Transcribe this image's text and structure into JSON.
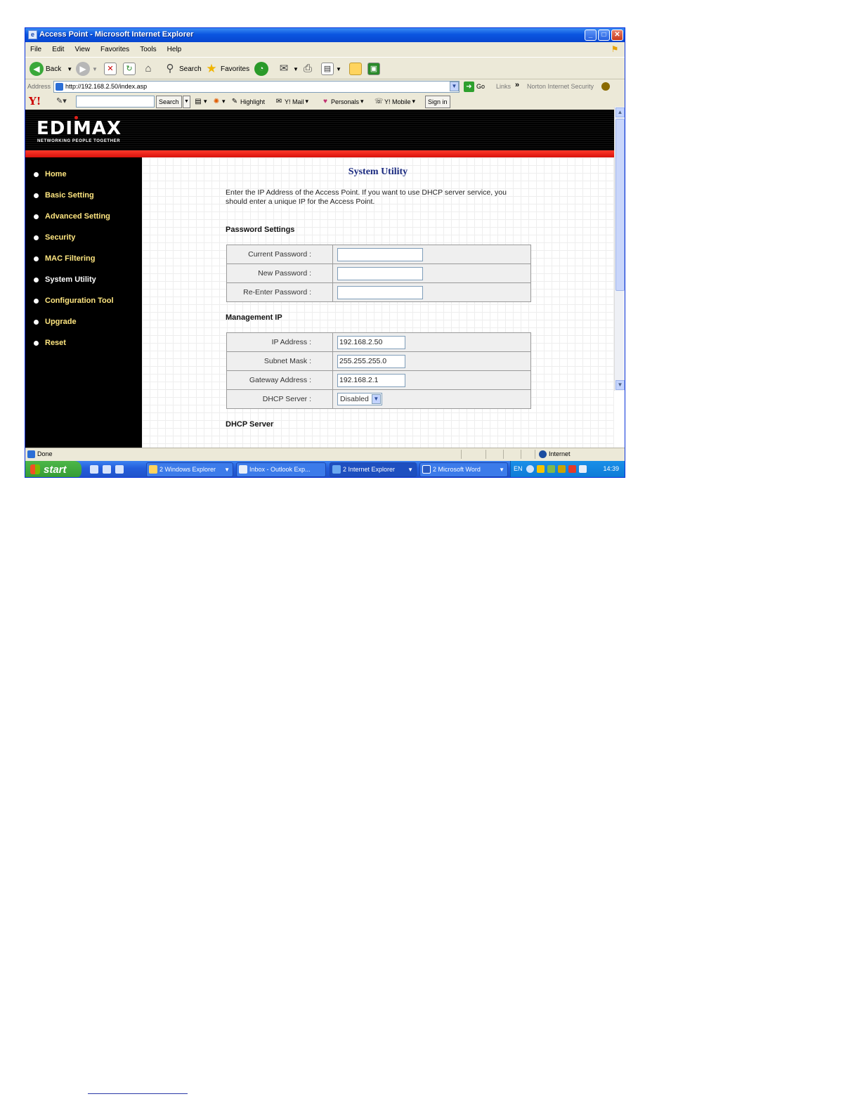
{
  "window": {
    "title": "Access Point - Microsoft Internet Explorer"
  },
  "menubar": {
    "items": [
      "File",
      "Edit",
      "View",
      "Favorites",
      "Tools",
      "Help"
    ]
  },
  "toolbar": {
    "back": "Back",
    "search": "Search",
    "favorites": "Favorites"
  },
  "address": {
    "label": "Address",
    "url": "http://192.168.2.50/index.asp",
    "go": "Go",
    "links": "Links",
    "norton": "Norton Internet Security"
  },
  "yahoo": {
    "logo": "Y!",
    "search_btn": "Search",
    "highlight": "Highlight",
    "mail": "Y! Mail",
    "personals": "Personals",
    "mobile": "Y! Mobile",
    "signin": "Sign in"
  },
  "brand": {
    "logo": "EDIMAX",
    "tagline": "NETWORKING PEOPLE TOGETHER"
  },
  "nav": {
    "items": [
      {
        "label": "Home"
      },
      {
        "label": "Basic Setting"
      },
      {
        "label": "Advanced Setting"
      },
      {
        "label": "Security"
      },
      {
        "label": "MAC Filtering"
      },
      {
        "label": "System Utility"
      },
      {
        "label": "Configuration Tool"
      },
      {
        "label": "Upgrade"
      },
      {
        "label": "Reset"
      }
    ],
    "active": "System Utility"
  },
  "main": {
    "title": "System Utility",
    "intro": "Enter the IP Address of the Access Point. If you want to use DHCP server service, you should enter a unique IP for the Access Point.",
    "password_section": "Password Settings",
    "password_fields": [
      {
        "label": "Current Password :",
        "value": ""
      },
      {
        "label": "New Password :",
        "value": ""
      },
      {
        "label": "Re-Enter Password :",
        "value": ""
      }
    ],
    "mgmt_section": "Management IP",
    "mgmt_fields": [
      {
        "label": "IP Address :",
        "value": "192.168.2.50"
      },
      {
        "label": "Subnet Mask :",
        "value": "255.255.255.0"
      },
      {
        "label": "Gateway Address :",
        "value": "192.168.2.1"
      },
      {
        "label": "DHCP Server :",
        "value": "Disabled"
      }
    ],
    "dhcp_section": "DHCP Server"
  },
  "status": {
    "text": "Done",
    "zone": "Internet"
  },
  "taskbar": {
    "start": "start",
    "tasks": [
      "2 Windows Explorer",
      "Inbox - Outlook Exp...",
      "2 Internet Explorer",
      "2 Microsoft Word"
    ],
    "lang": "EN",
    "clock": "14:39"
  }
}
